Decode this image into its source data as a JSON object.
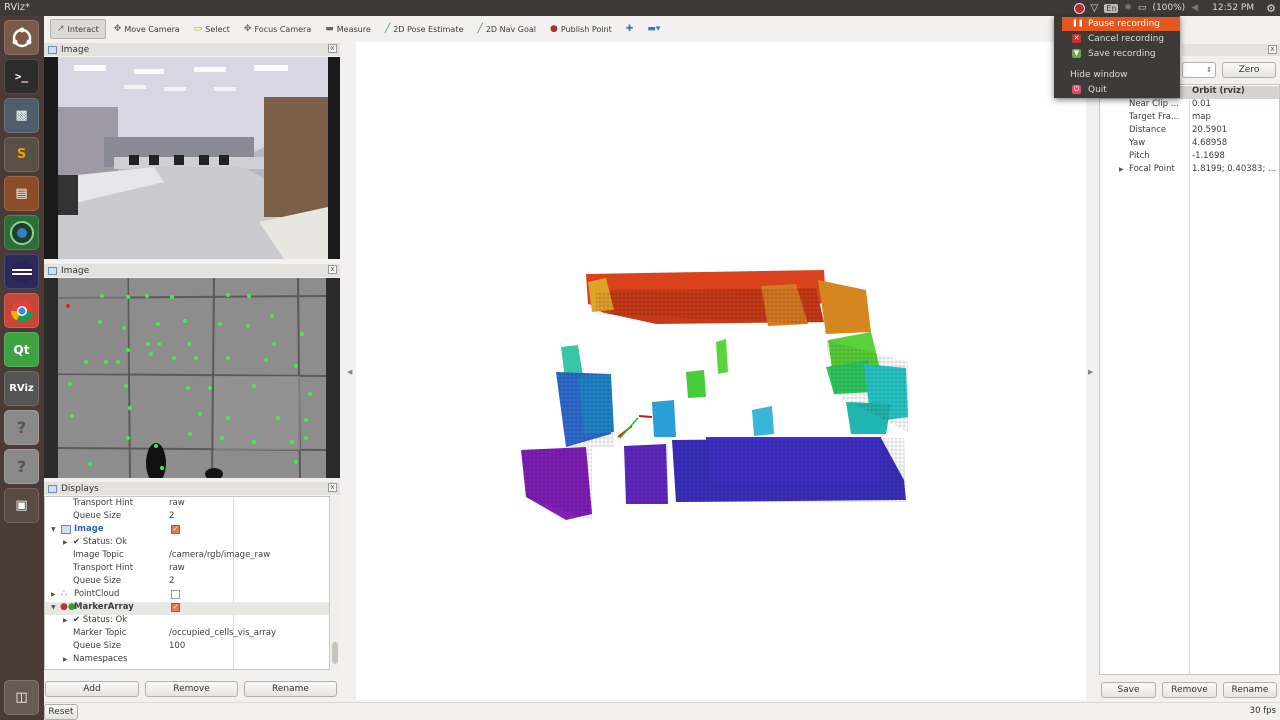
{
  "window": {
    "title": "RViz*"
  },
  "tray": {
    "battery": "(100%)",
    "clock": "12:52 PM",
    "keyboard": "En"
  },
  "toolbar": {
    "tools": [
      {
        "label": "Interact",
        "icon": "interact-icon",
        "glyph": "↗"
      },
      {
        "label": "Move Camera",
        "icon": "move-camera-icon",
        "glyph": "✥"
      },
      {
        "label": "Select",
        "icon": "select-icon",
        "glyph": "▭"
      },
      {
        "label": "Focus Camera",
        "icon": "focus-camera-icon",
        "glyph": "⌖"
      },
      {
        "label": "Measure",
        "icon": "measure-icon",
        "glyph": "━"
      },
      {
        "label": "2D Pose Estimate",
        "icon": "pose-estimate-icon",
        "glyph": "╱"
      },
      {
        "label": "2D Nav Goal",
        "icon": "nav-goal-icon",
        "glyph": "╱"
      },
      {
        "label": "Publish Point",
        "icon": "publish-point-icon",
        "glyph": "●"
      }
    ]
  },
  "image_panel_1": {
    "title": "Image"
  },
  "image_panel_2": {
    "title": "Image"
  },
  "displays": {
    "title": "Displays",
    "rows": [
      {
        "key": "Transport Hint",
        "value": "raw",
        "indent": 28
      },
      {
        "key": "Queue Size",
        "value": "2",
        "indent": 28
      },
      {
        "key": "Image",
        "value": "",
        "indent": 28,
        "checkbox": true,
        "checked": true,
        "bold": true
      },
      {
        "key": "✔ Status: Ok",
        "value": "",
        "indent": 28
      },
      {
        "key": "Image Topic",
        "value": "/camera/rgb/image_raw",
        "indent": 28
      },
      {
        "key": "Transport Hint",
        "value": "raw",
        "indent": 28
      },
      {
        "key": "Queue Size",
        "value": "2",
        "indent": 28
      },
      {
        "key": "PointCloud",
        "value": "",
        "indent": 29,
        "checkbox": true,
        "checked": false
      },
      {
        "key": "MarkerArray",
        "value": "",
        "indent": 29,
        "checkbox": true,
        "checked": true
      },
      {
        "key": "✔ Status: Ok",
        "value": "",
        "indent": 28
      },
      {
        "key": "Marker Topic",
        "value": "/occupied_cells_vis_array",
        "indent": 28
      },
      {
        "key": "Queue Size",
        "value": "100",
        "indent": 28
      },
      {
        "key": "Namespaces",
        "value": "",
        "indent": 28
      }
    ],
    "buttons": {
      "add": "Add",
      "remove": "Remove",
      "rename": "Rename"
    }
  },
  "views": {
    "zero_label": "Zero",
    "type_value": "Orbit (rviz)",
    "rows": [
      {
        "key": "Near Clip ...",
        "value": "0.01"
      },
      {
        "key": "Target Fra...",
        "value": "map"
      },
      {
        "key": "Distance",
        "value": "20.5901"
      },
      {
        "key": "Yaw",
        "value": "4.68958"
      },
      {
        "key": "Pitch",
        "value": "-1.1698"
      },
      {
        "key": "Focal Point",
        "value": "1.8199; 0.40383; ..."
      }
    ],
    "buttons": {
      "save": "Save",
      "remove": "Remove",
      "rename": "Rename"
    }
  },
  "status": {
    "reset_label": "Reset",
    "fps": "30 fps"
  },
  "recording_menu": {
    "pause": "Pause recording",
    "cancel": "Cancel recording",
    "save": "Save recording",
    "hide": "Hide window",
    "quit": "Quit"
  },
  "colors": {
    "accent_orange": "#e2581f",
    "launcher_bg": "#4a3b36",
    "topbar_bg": "#3c3b37"
  }
}
